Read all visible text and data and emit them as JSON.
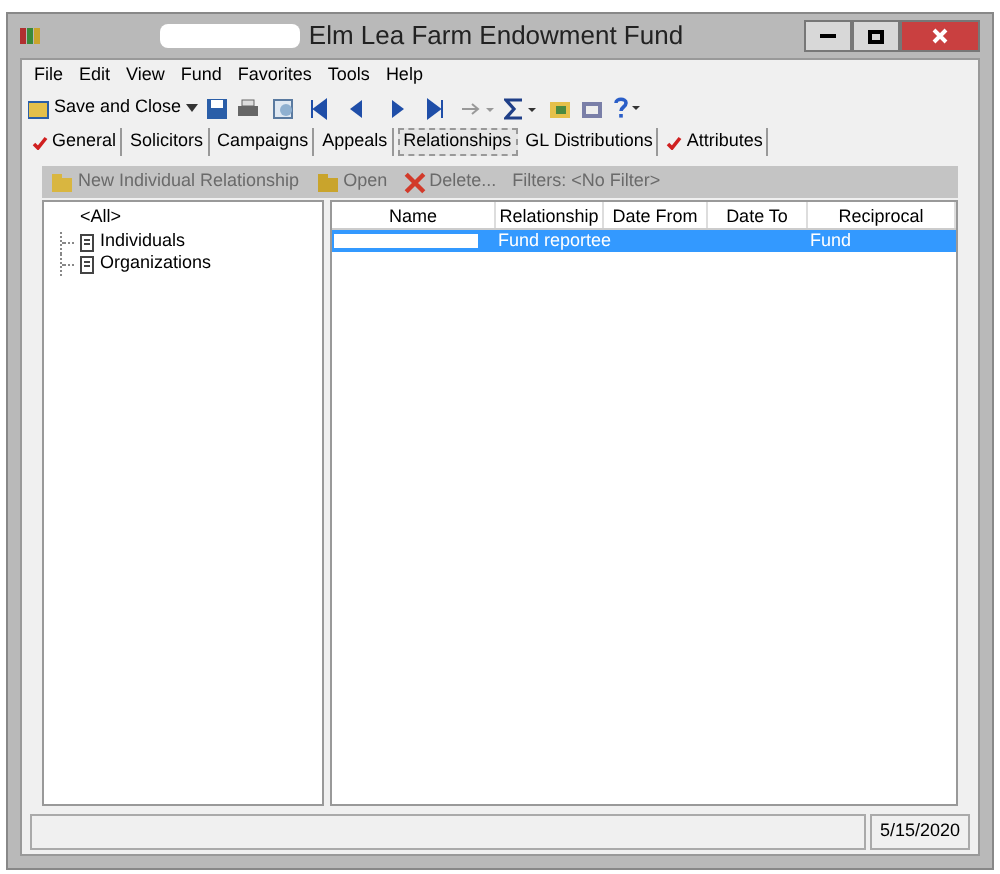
{
  "window": {
    "title": "Elm Lea Farm Endowment Fund"
  },
  "menu": [
    "File",
    "Edit",
    "View",
    "Fund",
    "Favorites",
    "Tools",
    "Help"
  ],
  "toolbar": {
    "save_label": "Save and Close"
  },
  "tabs": [
    {
      "label": "General",
      "checked": true,
      "selected": false
    },
    {
      "label": "Solicitors",
      "checked": false,
      "selected": false
    },
    {
      "label": "Campaigns",
      "checked": false,
      "selected": false
    },
    {
      "label": "Appeals",
      "checked": false,
      "selected": false
    },
    {
      "label": "Relationships",
      "checked": false,
      "selected": true
    },
    {
      "label": "GL Distributions",
      "checked": false,
      "selected": false
    },
    {
      "label": "Attributes",
      "checked": true,
      "selected": false
    }
  ],
  "sub_toolbar": [
    {
      "kind": "new",
      "label": "New Individual Relationship",
      "disabled": true
    },
    {
      "kind": "open",
      "label": "Open",
      "disabled": true
    },
    {
      "kind": "delete",
      "label": "Delete...",
      "disabled": true
    },
    {
      "kind": "filter",
      "label": "Filters: <No Filter>",
      "disabled": true
    }
  ],
  "tree": {
    "label": "<All>",
    "children": [
      {
        "label": "Individuals"
      },
      {
        "label": "Organizations"
      }
    ]
  },
  "table": {
    "columns": [
      "Name",
      "Relationship",
      "Date From",
      "Date To",
      "Reciprocal"
    ],
    "rows": [
      {
        "selected": true,
        "cells": [
          "",
          "Fund reportee",
          "",
          "",
          "Fund"
        ]
      }
    ]
  },
  "status_bar": {
    "date": "5/15/2020"
  }
}
